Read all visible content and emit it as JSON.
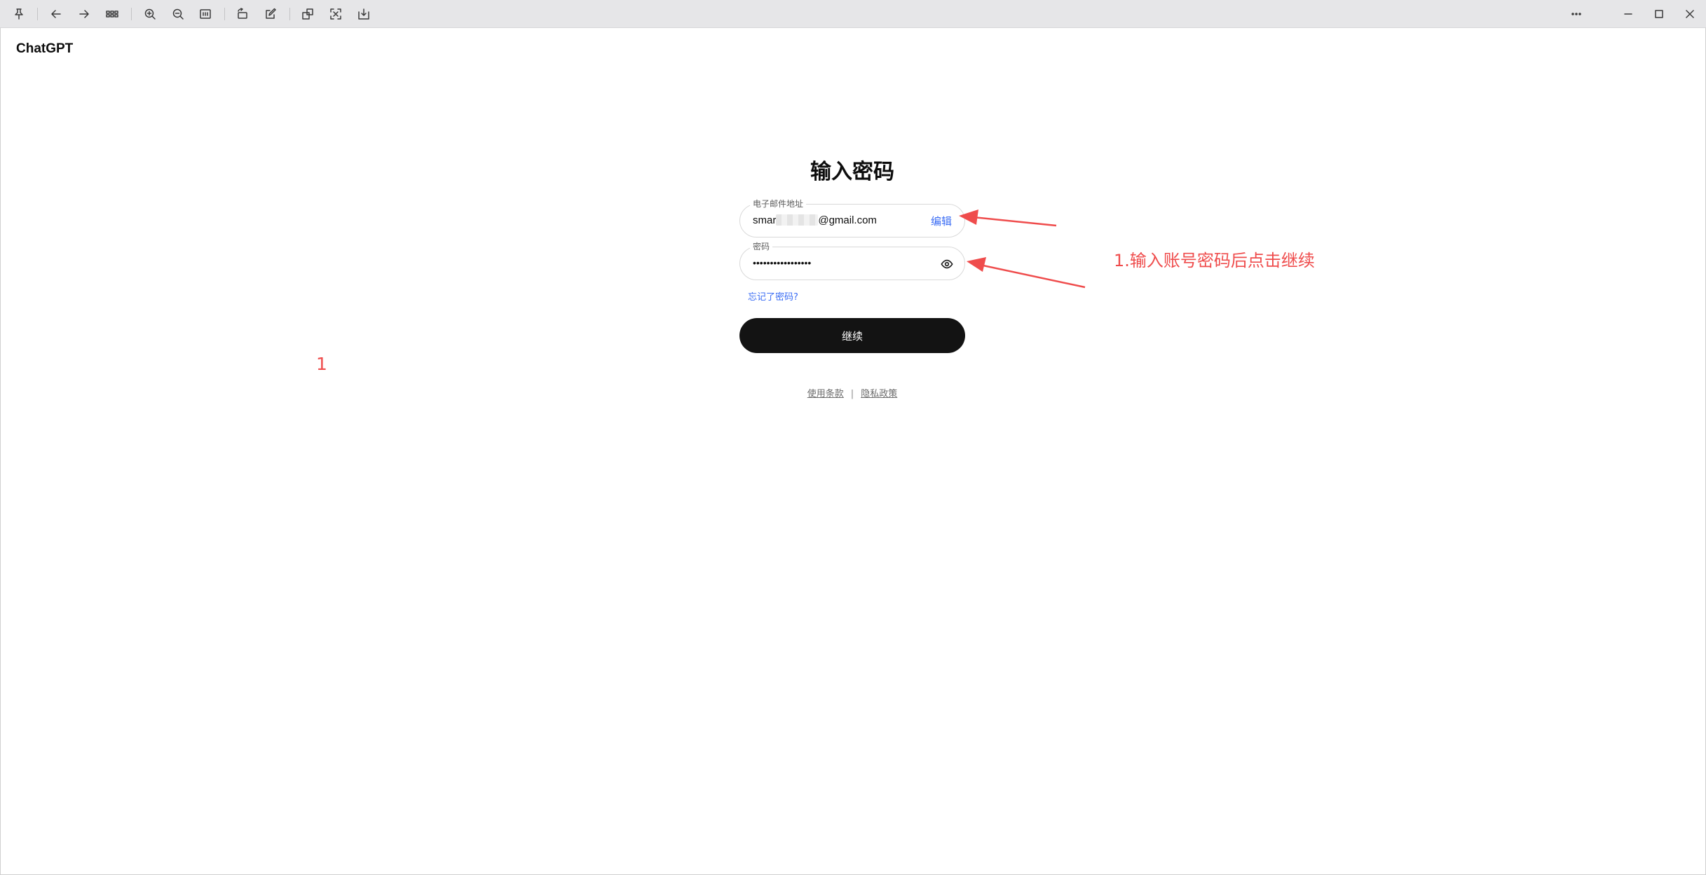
{
  "viewer": {
    "toolbar_icons": [
      "pin-icon",
      "back-arrow-icon",
      "forward-arrow-icon",
      "grid-icon",
      "zoom-in-icon",
      "zoom-out-icon",
      "fit-width-icon",
      "rotate-icon",
      "edit-icon",
      "crop-icon",
      "screenshot-icon",
      "export-icon",
      "more-icon",
      "minimize-icon",
      "maximize-icon",
      "close-icon"
    ]
  },
  "app": {
    "brand": "ChatGPT"
  },
  "login": {
    "title": "输入密码",
    "email_label": "电子邮件地址",
    "email_prefix": "smar",
    "email_suffix": "@gmail.com",
    "edit_label": "编辑",
    "password_label": "密码",
    "password_masked": "•••••••••••••••••",
    "show_password_icon": "eye-icon",
    "forgot_password": "忘记了密码?",
    "continue_label": "继续",
    "terms_link": "使用条款",
    "separator": "|",
    "privacy_link": "隐私政策"
  },
  "annotations": {
    "instruction": "1.输入账号密码后点击继续",
    "step_number": "1",
    "color": "#ef4c4c"
  },
  "colors": {
    "accent_link": "#3a6cf4",
    "button_bg": "#131313",
    "toolbar_bg": "#e6e6e8"
  }
}
